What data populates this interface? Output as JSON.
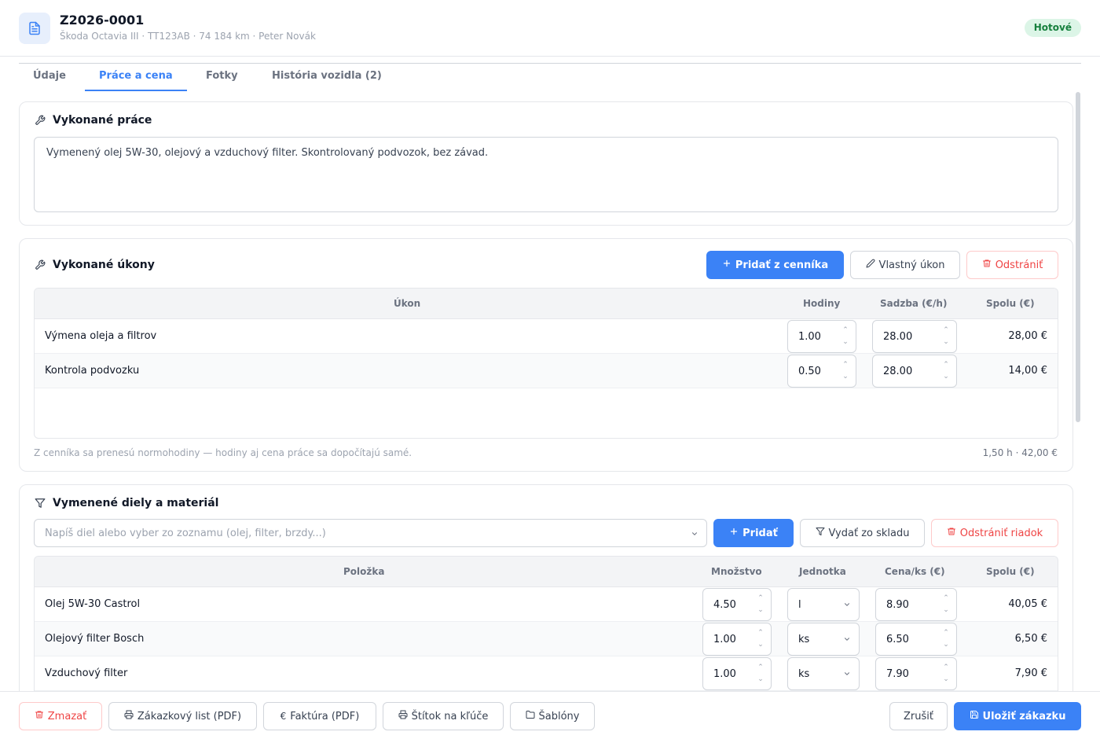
{
  "header": {
    "title": "Z2026-0001",
    "subtitle": "Škoda Octavia III · TT123AB · 74 184 km · Peter Novák",
    "status": "Hotové"
  },
  "tabs": [
    {
      "label": "Údaje"
    },
    {
      "label": "Práce a cena"
    },
    {
      "label": "Fotky"
    },
    {
      "label": "História vozidla (2)"
    }
  ],
  "active_tab": "Práce a cena",
  "work": {
    "title": "Vykonané práce",
    "description": "Vymenený olej 5W-30, olejový a vzduchový filter. Skontrolovaný podvozok, bez závad."
  },
  "tasks": {
    "title": "Vykonané úkony",
    "add_from_pricelist": "Pridať z cenníka",
    "custom_task": "Vlastný úkon",
    "remove": "Odstrániť",
    "columns": [
      "Úkon",
      "Hodiny",
      "Sadzba (€/h)",
      "Spolu (€)"
    ],
    "rows": [
      {
        "name": "Výmena oleja a filtrov",
        "hours": "1.00",
        "rate": "28.00",
        "total": "28,00 €"
      },
      {
        "name": "Kontrola podvozku",
        "hours": "0.50",
        "rate": "28.00",
        "total": "14,00 €"
      }
    ],
    "note": "Z cenníka sa prenesú normohodiny — hodiny aj cena práce sa dopočítajú samé.",
    "summary": "1,50 h · 42,00 €"
  },
  "parts": {
    "title": "Vymenené diely a materiál",
    "search_placeholder": "Napíš diel alebo vyber zo zoznamu (olej, filter, brzdy...)",
    "add": "Pridať",
    "from_stock": "Vydať zo skladu",
    "remove_row": "Odstrániť riadok",
    "columns": [
      "Položka",
      "Množstvo",
      "Jednotka",
      "Cena/ks (€)",
      "Spolu (€)"
    ],
    "rows": [
      {
        "name": "Olej 5W-30 Castrol",
        "qty": "4.50",
        "unit": "l",
        "price": "8.90",
        "total": "40,05 €"
      },
      {
        "name": "Olejový filter Bosch",
        "qty": "1.00",
        "unit": "ks",
        "price": "6.50",
        "total": "6,50 €"
      },
      {
        "name": "Vzduchový filter",
        "qty": "1.00",
        "unit": "ks",
        "price": "7.90",
        "total": "7,90 €"
      }
    ]
  },
  "footer": {
    "delete": "Zmazať",
    "order_sheet": "Zákazkový list (PDF)",
    "invoice": "Faktúra (PDF)",
    "key_tag": "Štítok na kľúče",
    "templates": "Šablóny",
    "cancel": "Zrušiť",
    "save": "Uložiť zákazku"
  },
  "colors": {
    "accent": "#3b82f6",
    "danger": "#ef4444",
    "status_bg": "#dcf5e7",
    "status_text": "#15803d"
  },
  "icons": [
    "document-icon",
    "wrench-icon",
    "funnel-icon",
    "plus-icon",
    "pencil-icon",
    "trash-icon",
    "printer-icon",
    "euro-icon",
    "folder-icon",
    "save-icon",
    "chevron-down-icon"
  ]
}
